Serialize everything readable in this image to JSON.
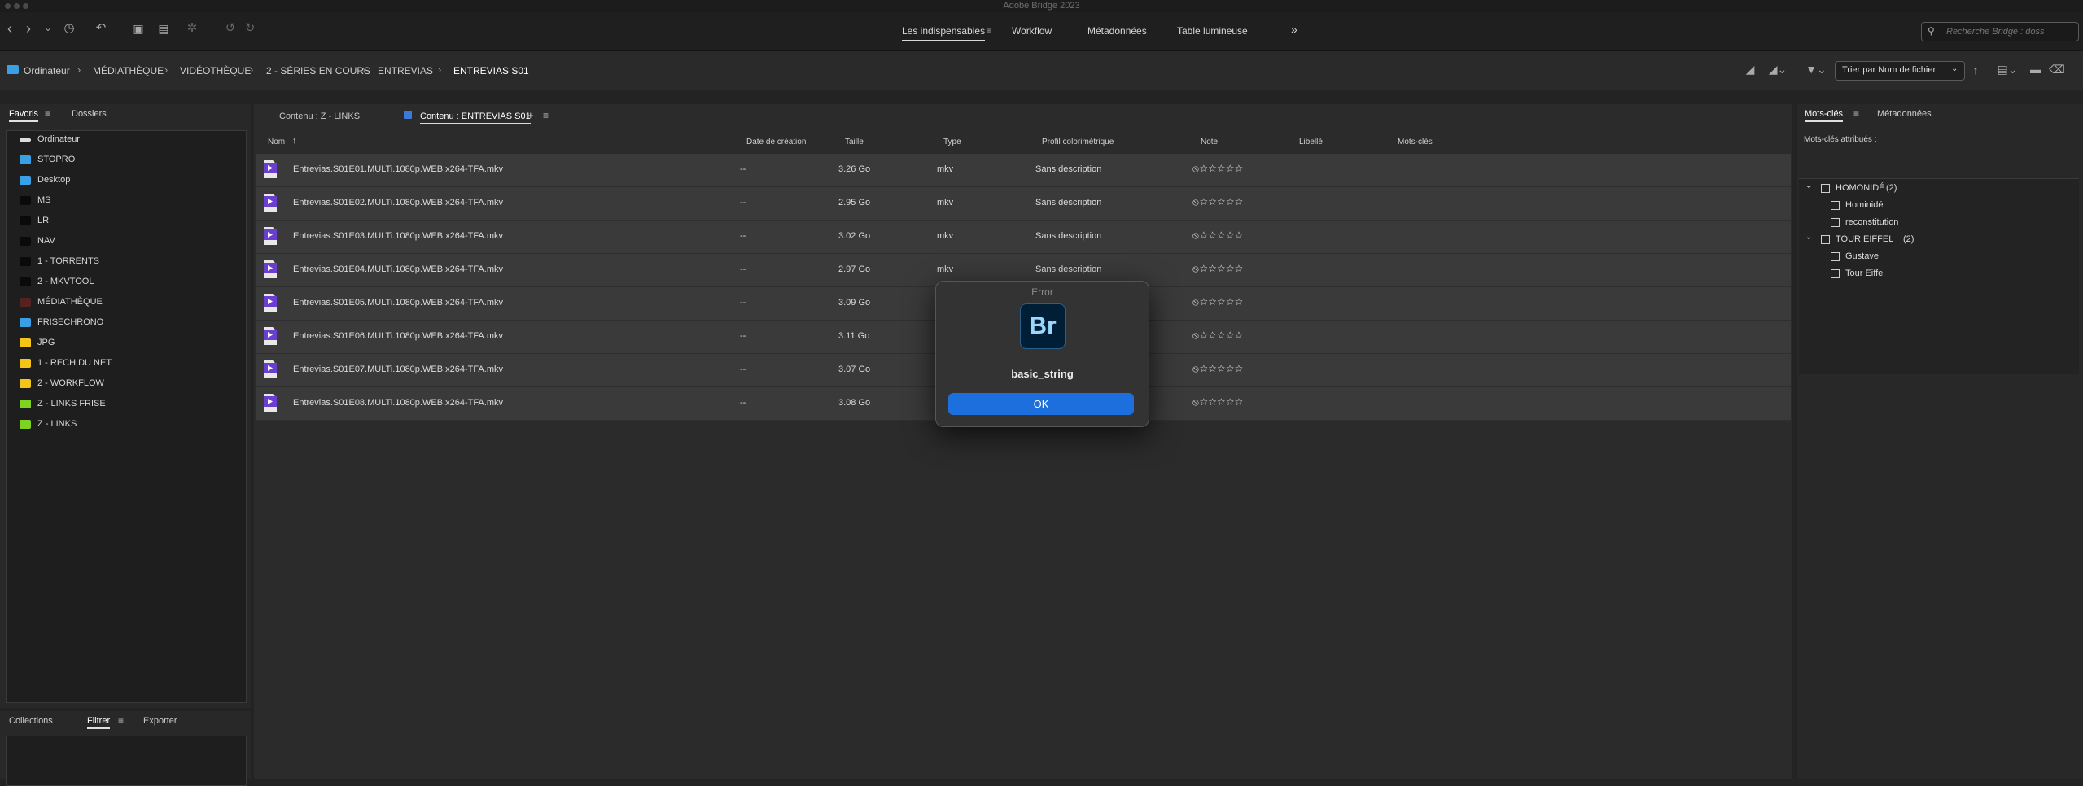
{
  "app": {
    "title": "Adobe Bridge 2023"
  },
  "workspace": {
    "tabs": [
      "Les indispensables",
      "Workflow",
      "Métadonnées",
      "Table lumineuse"
    ],
    "more": "»"
  },
  "search": {
    "placeholder": "Recherche Bridge : doss"
  },
  "path": {
    "crumbs": [
      "Ordinateur",
      "MÉDIATHÈQUE",
      "VIDÉOTHÈQUE",
      "2 - SÉRIES EN COURS",
      "ENTREVIAS",
      "ENTREVIAS S01"
    ],
    "separator": "›"
  },
  "sort": {
    "label": "Trier par Nom de fichier",
    "arrow": "↑"
  },
  "left_panel": {
    "tabs": [
      "Favoris",
      "Dossiers"
    ],
    "favorites": [
      {
        "label": "Ordinateur",
        "color": "#dddddd"
      },
      {
        "label": "STOPRO",
        "color": "#3aa0e6"
      },
      {
        "label": "Desktop",
        "color": "#3aa0e6"
      },
      {
        "label": "MS",
        "color": "#0a0a0a"
      },
      {
        "label": "LR",
        "color": "#0a0a0a"
      },
      {
        "label": "NAV",
        "color": "#0a0a0a"
      },
      {
        "label": "1 - TORRENTS",
        "color": "#0a0a0a"
      },
      {
        "label": "2 - MKVTOOL",
        "color": "#0a0a0a"
      },
      {
        "label": "MÉDIATHÈQUE",
        "color": "#552222"
      },
      {
        "label": "FRISECHRONO",
        "color": "#3aa0e6"
      },
      {
        "label": "JPG",
        "color": "#f5c518"
      },
      {
        "label": "1 - RECH DU NET",
        "color": "#f5c518"
      },
      {
        "label": "2 - WORKFLOW",
        "color": "#f5c518"
      },
      {
        "label": "Z - LINKS FRISE",
        "color": "#7ed321"
      },
      {
        "label": "Z - LINKS",
        "color": "#7ed321"
      }
    ],
    "bottom_tabs": [
      "Collections",
      "Filtrer",
      "Exporter"
    ]
  },
  "content": {
    "tabs": [
      "Contenu : Z - LINKS",
      "Contenu : ENTREVIAS S01"
    ],
    "tab_add": "+",
    "columns": [
      "Nom",
      "Date de création",
      "Taille",
      "Type",
      "Profil colorimétrique",
      "Note",
      "Libellé",
      "Mots-clés"
    ],
    "sort_arrow": "↑",
    "rows": [
      {
        "name": "Entrevias.S01E01.MULTi.1080p.WEB.x264-TFA.mkv",
        "date": "--",
        "size": "3.26 Go",
        "type": "mkv",
        "profile": "Sans description"
      },
      {
        "name": "Entrevias.S01E02.MULTi.1080p.WEB.x264-TFA.mkv",
        "date": "--",
        "size": "2.95 Go",
        "type": "mkv",
        "profile": "Sans description"
      },
      {
        "name": "Entrevias.S01E03.MULTi.1080p.WEB.x264-TFA.mkv",
        "date": "--",
        "size": "3.02 Go",
        "type": "mkv",
        "profile": "Sans description"
      },
      {
        "name": "Entrevias.S01E04.MULTi.1080p.WEB.x264-TFA.mkv",
        "date": "--",
        "size": "2.97 Go",
        "type": "mkv",
        "profile": "Sans description"
      },
      {
        "name": "Entrevias.S01E05.MULTi.1080p.WEB.x264-TFA.mkv",
        "date": "--",
        "size": "3.09 Go",
        "type": "",
        "profile": ""
      },
      {
        "name": "Entrevias.S01E06.MULTi.1080p.WEB.x264-TFA.mkv",
        "date": "--",
        "size": "3.11 Go",
        "type": "",
        "profile": ""
      },
      {
        "name": "Entrevias.S01E07.MULTi.1080p.WEB.x264-TFA.mkv",
        "date": "--",
        "size": "3.07 Go",
        "type": "",
        "profile": ""
      },
      {
        "name": "Entrevias.S01E08.MULTi.1080p.WEB.x264-TFA.mkv",
        "date": "--",
        "size": "3.08 Go",
        "type": "",
        "profile": ""
      }
    ],
    "rating_stars": "⦸☆☆☆☆☆"
  },
  "right_panel": {
    "tabs": [
      "Mots-clés",
      "Métadonnées"
    ],
    "assigned_label": "Mots-clés attribués :",
    "groups": [
      {
        "name": "HOMONIDÉ",
        "count": "(2)",
        "items": [
          "Hominidé",
          "reconstitution"
        ]
      },
      {
        "name": "TOUR EIFFEL",
        "count": "(2)",
        "items": [
          "Gustave",
          "Tour Eiffel"
        ]
      }
    ]
  },
  "dialog": {
    "title": "Error",
    "icon_text": "Br",
    "message": "basic_string",
    "button": "OK"
  },
  "colors": {
    "accent": "#1d6fde",
    "dialog_icon_bg": "#001e36",
    "dialog_icon_fg": "#9ad7ff",
    "file_icon": "#6a3fd0"
  }
}
